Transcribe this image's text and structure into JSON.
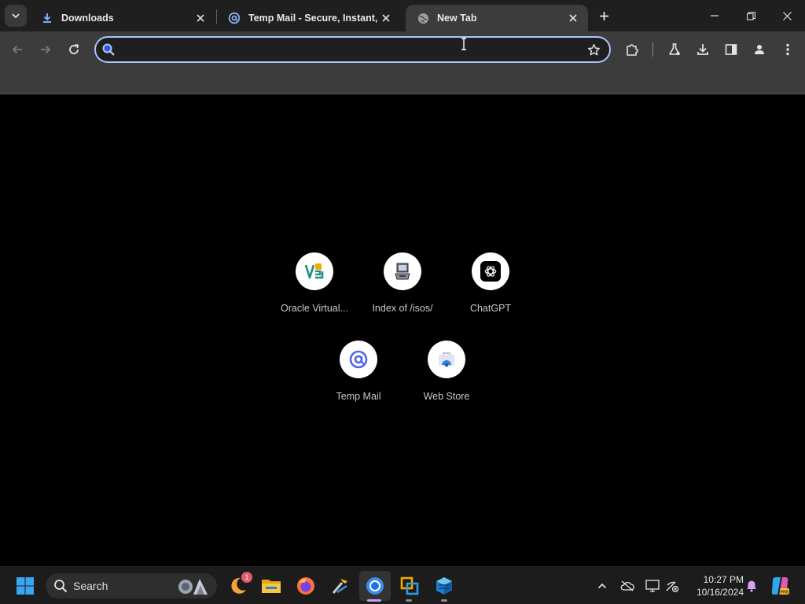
{
  "browser": {
    "tabs": [
      {
        "title": "Downloads",
        "icon": "download-icon"
      },
      {
        "title": "Temp Mail - Secure, Instant, Fa",
        "icon": "at-sign-icon"
      },
      {
        "title": "New Tab",
        "icon": "globe-icon"
      }
    ],
    "active_tab_index": 2
  },
  "omnibox": {
    "value": "",
    "placeholder": ""
  },
  "shortcuts": [
    {
      "label": "Oracle Virtual...",
      "icon": "virtualbox-icon"
    },
    {
      "label": "Index of /isos/",
      "icon": "computer-icon"
    },
    {
      "label": "ChatGPT",
      "icon": "chatgpt-icon"
    },
    {
      "label": "Temp Mail",
      "icon": "at-sign-icon"
    },
    {
      "label": "Web Store",
      "icon": "web-store-icon"
    }
  ],
  "taskbar": {
    "search_label": "Search",
    "time": "10:27 PM",
    "date": "10/16/2024",
    "notification_badge": "1"
  },
  "colors": {
    "tab_strip": "#1f1f1f",
    "toolbar": "#3c3c3c",
    "omnibox_focus": "#a8c7fa",
    "page_background": "#000000",
    "taskbar": "#1c1c1c"
  }
}
